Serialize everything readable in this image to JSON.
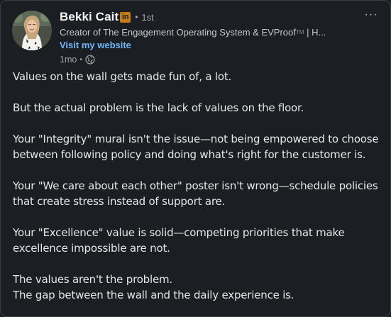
{
  "author": {
    "name": "Bekki Cait",
    "linkedin_badge": "in",
    "connection_degree": "1st",
    "headline": "Creator of The Engagement Operating System & EVProof",
    "headline_tm": "TM",
    "headline_more": "| H...",
    "website_label": "Visit my website",
    "post_age": "1mo",
    "visibility_icon": "globe-icon"
  },
  "menu": {
    "more_icon": "ellipsis-icon",
    "more_label": "···"
  },
  "post": {
    "paragraphs": [
      [
        "Values on the wall gets made fun of, a lot."
      ],
      [
        "But the actual problem is the lack of values on the floor."
      ],
      [
        "Your \"Integrity\" mural isn't the issue—not being empowered to choose",
        "between following policy and doing what's right for the customer is."
      ],
      [
        "Your \"We care about each other\" poster isn't wrong—schedule policies",
        "that create stress instead of support are."
      ],
      [
        "Your \"Excellence\" value is solid—competing priorities that make",
        "excellence impossible are not."
      ],
      [
        "The values aren't the problem.",
        "The gap between the wall and the daily experience is."
      ]
    ]
  },
  "colors": {
    "background": "#1b1f23",
    "text": "#e6e6e6",
    "link": "#71b7fb",
    "badge": "#c37d16",
    "muted": "#a6a6a6"
  }
}
